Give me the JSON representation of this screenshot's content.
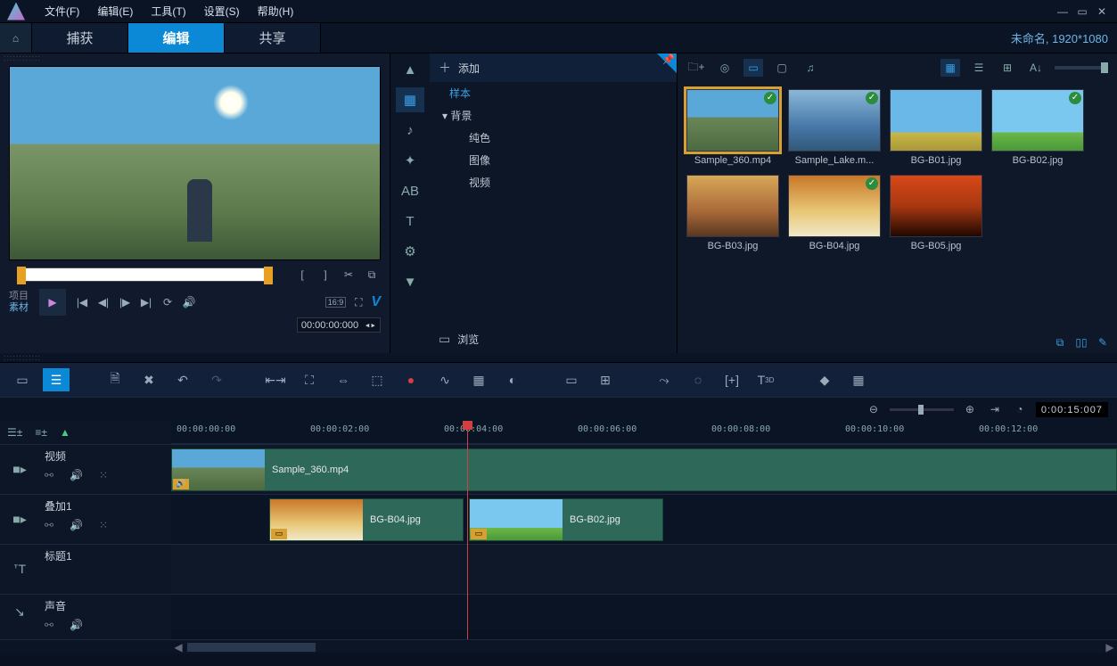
{
  "menu": {
    "file": "文件(F)",
    "edit": "编辑(E)",
    "tools": "工具(T)",
    "settings": "设置(S)",
    "help": "帮助(H)"
  },
  "tabs": {
    "capture": "捕获",
    "edit": "编辑",
    "share": "共享"
  },
  "project": {
    "title": "未命名, 1920*1080"
  },
  "preview": {
    "project_label": "项目",
    "clip_label": "素材",
    "timecode": "00:00:00:000",
    "aspect": "16:9"
  },
  "library": {
    "add": "添加",
    "browse": "浏览",
    "tree": {
      "samples": "样本",
      "backgrounds": "背景",
      "solid": "纯色",
      "image": "图像",
      "video": "视频"
    },
    "thumbs": [
      {
        "name": "Sample_360.mp4",
        "bg": "linear-gradient(#5aa8d8 0%,#5aa8d8 45%,#6a8658 45%,#4c6a40 100%)",
        "chk": true,
        "sel": true
      },
      {
        "name": "Sample_Lake.m...",
        "bg": "linear-gradient(#8ab8d8,#4878a8 60%,#305878)",
        "chk": true
      },
      {
        "name": "BG-B01.jpg",
        "bg": "linear-gradient(#6ab8e8 0%,#6ab8e8 70%,#c8b848 70%,#a89838 100%)",
        "chk": false
      },
      {
        "name": "BG-B02.jpg",
        "bg": "linear-gradient(#7ac8f0 0%,#7ac8f0 70%,#6ab848 70%,#4a9838 100%)",
        "chk": true
      },
      {
        "name": "BG-B03.jpg",
        "bg": "linear-gradient(#d8a858 0%,#a86838 60%,#583820 100%)",
        "chk": false
      },
      {
        "name": "BG-B04.jpg",
        "bg": "linear-gradient(#c87828 0%,#e8c878 60%,#f0e8c8 100%)",
        "chk": true
      },
      {
        "name": "BG-B05.jpg",
        "bg": "linear-gradient(#d84818 0%,#a83810 50%,#200800 100%)",
        "chk": false
      }
    ]
  },
  "timeline": {
    "timecode": "0:00:15:007",
    "ticks": [
      "00:00:00:00",
      "00:00:02:00",
      "00:00:04:00",
      "00:00:06:00",
      "00:00:08:00",
      "00:00:10:00",
      "00:00:12:00"
    ],
    "tracks": {
      "video": "视频",
      "overlay": "叠加1",
      "title": "标题1",
      "audio": "声音"
    },
    "clips": {
      "main": "Sample_360.mp4",
      "ov1": "BG-B04.jpg",
      "ov2": "BG-B02.jpg"
    }
  }
}
